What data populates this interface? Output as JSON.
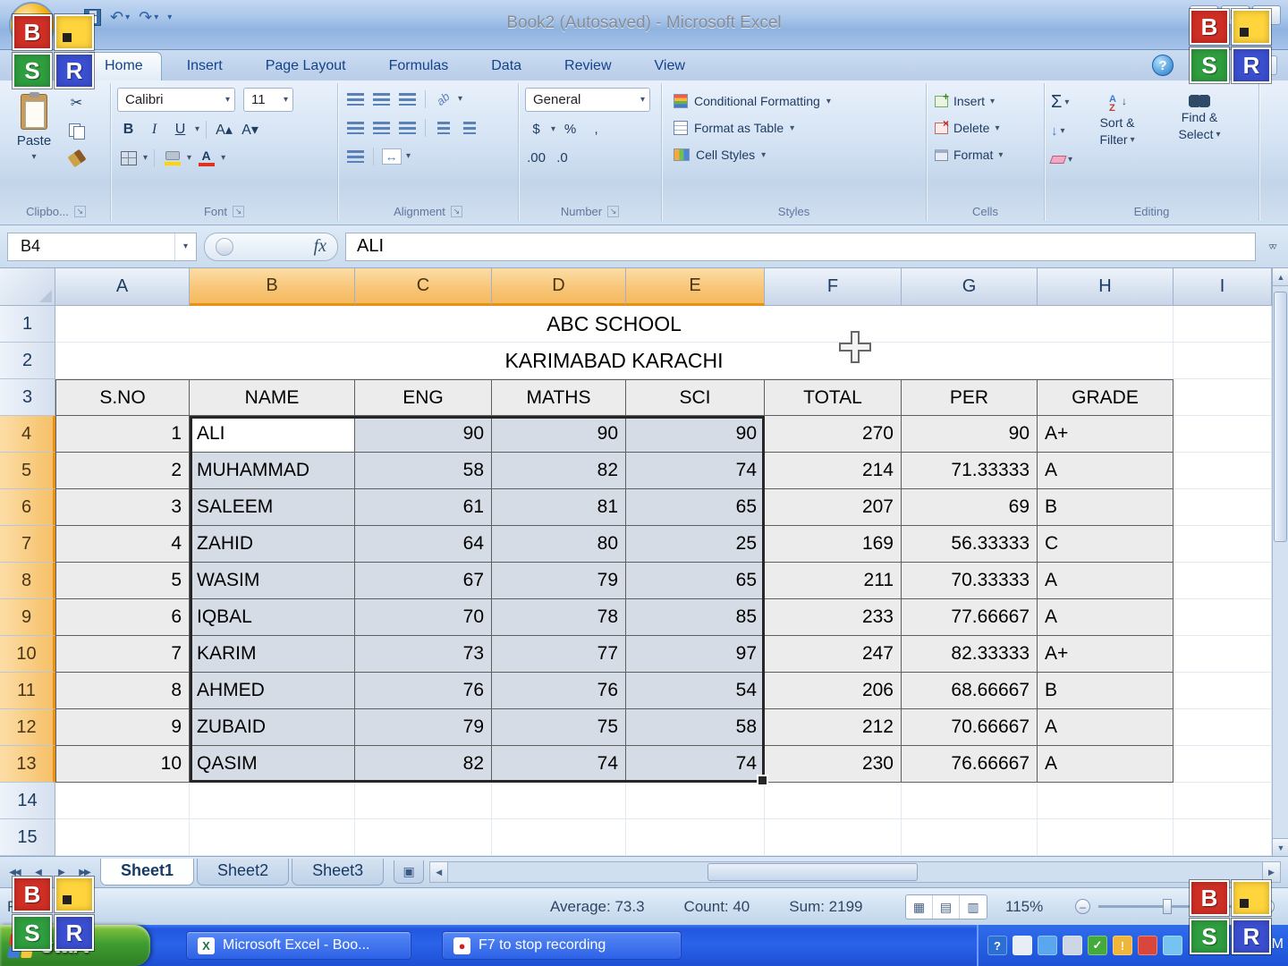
{
  "window": {
    "title": "Book2 (Autosaved) - Microsoft Excel",
    "minimize": "–",
    "maximize": "❐",
    "close": "×"
  },
  "icons": {
    "office-button": "css-shape",
    "save": "css-shape",
    "undo": "↶",
    "redo": "↷",
    "dropdown": "▾",
    "help": "?",
    "workbook-close": "×",
    "cut": "✂",
    "grow-font": "A▴",
    "shrink-font": "A▾",
    "orientation": "ab",
    "merge-center": "↔",
    "fill-down": "↓",
    "expand-formula-bar": "▿▿",
    "scroll-up": "▲",
    "scroll-down": "▼",
    "scroll-left": "◀",
    "scroll-right": "▶",
    "sheet-first": "◀◀",
    "sheet-prev": "◀",
    "sheet-next": "▶",
    "sheet-last": "▶▶",
    "insert-worksheet": "▣",
    "view-normal": "▦",
    "view-page-layout": "▤",
    "view-page-break": "▥",
    "zoom-out": "–",
    "zoom-in": "+",
    "sort-arrow": "↓"
  },
  "ribbon": {
    "tabs": [
      {
        "label": "Home",
        "active": true
      },
      {
        "label": "Insert"
      },
      {
        "label": "Page Layout"
      },
      {
        "label": "Formulas"
      },
      {
        "label": "Data"
      },
      {
        "label": "Review"
      },
      {
        "label": "View"
      }
    ],
    "groups": {
      "clipboard": {
        "label": "Clipbo...",
        "paste": "Paste"
      },
      "font": {
        "label": "Font",
        "name": "Calibri",
        "size": "11",
        "bold": "B",
        "italic": "I",
        "underline": "U"
      },
      "alignment": {
        "label": "Alignment"
      },
      "number": {
        "label": "Number",
        "format": "General",
        "currency": "$",
        "percent": "%",
        "comma": ",",
        "inc_decimal": ".00",
        "dec_decimal": ".0"
      },
      "styles": {
        "label": "Styles",
        "conditional": "Conditional Formatting",
        "table": "Format as Table",
        "cell_styles": "Cell Styles"
      },
      "cells": {
        "label": "Cells",
        "insert": "Insert",
        "delete": "Delete",
        "format": "Format"
      },
      "editing": {
        "label": "Editing",
        "autosum": "Σ",
        "sort_line1": "Sort &",
        "sort_line2": "Filter",
        "find_line1": "Find &",
        "find_line2": "Select"
      }
    }
  },
  "formula_bar": {
    "name_box": "B4",
    "fx": "fx",
    "content": "ALI"
  },
  "grid": {
    "columns": [
      "A",
      "B",
      "C",
      "D",
      "E",
      "F",
      "G",
      "H",
      "I"
    ],
    "selection": {
      "range": "B4:E13",
      "active_cell": "B4",
      "col_start": 1,
      "col_end": 4,
      "row_start": 4,
      "row_end": 13
    },
    "rows": [
      {
        "n": 1,
        "merged": "ABC SCHOOL"
      },
      {
        "n": 2,
        "merged": "KARIMABAD KARACHI"
      },
      {
        "n": 3,
        "header": true,
        "cells": [
          "S.NO",
          "NAME",
          "ENG",
          "MATHS",
          "SCI",
          "TOTAL",
          "PER",
          "GRADE"
        ]
      },
      {
        "n": 4,
        "cells": [
          "1",
          "ALI",
          "90",
          "90",
          "90",
          "270",
          "90",
          "A+"
        ]
      },
      {
        "n": 5,
        "cells": [
          "2",
          "MUHAMMAD",
          "58",
          "82",
          "74",
          "214",
          "71.33333",
          "A"
        ]
      },
      {
        "n": 6,
        "cells": [
          "3",
          "SALEEM",
          "61",
          "81",
          "65",
          "207",
          "69",
          "B"
        ]
      },
      {
        "n": 7,
        "cells": [
          "4",
          "ZAHID",
          "64",
          "80",
          "25",
          "169",
          "56.33333",
          "C"
        ]
      },
      {
        "n": 8,
        "cells": [
          "5",
          "WASIM",
          "67",
          "79",
          "65",
          "211",
          "70.33333",
          "A"
        ]
      },
      {
        "n": 9,
        "cells": [
          "6",
          "IQBAL",
          "70",
          "78",
          "85",
          "233",
          "77.66667",
          "A"
        ]
      },
      {
        "n": 10,
        "cells": [
          "7",
          "KARIM",
          "73",
          "77",
          "97",
          "247",
          "82.33333",
          "A+"
        ]
      },
      {
        "n": 11,
        "cells": [
          "8",
          "AHMED",
          "76",
          "76",
          "54",
          "206",
          "68.66667",
          "B"
        ]
      },
      {
        "n": 12,
        "cells": [
          "9",
          "ZUBAID",
          "79",
          "75",
          "58",
          "212",
          "70.66667",
          "A"
        ]
      },
      {
        "n": 13,
        "cells": [
          "10",
          "QASIM",
          "82",
          "74",
          "74",
          "230",
          "76.66667",
          "A"
        ]
      },
      {
        "n": 14,
        "cells": []
      },
      {
        "n": 15,
        "cells": []
      }
    ]
  },
  "sheet_bar": {
    "tabs": [
      {
        "label": "Sheet1",
        "active": true
      },
      {
        "label": "Sheet2"
      },
      {
        "label": "Sheet3"
      }
    ]
  },
  "status_bar": {
    "mode": "R",
    "average": "Average: 73.3",
    "count": "Count: 40",
    "sum": "Sum: 2199",
    "zoom": "115%"
  },
  "taskbar": {
    "start": "start",
    "tasks": [
      {
        "label": "Microsoft Excel - Boo...",
        "icon": "excel-icon",
        "glyph": "X"
      },
      {
        "label": "F7 to stop recording",
        "icon": "recorder-icon",
        "glyph": "●"
      }
    ],
    "tray_icons": [
      "help-icon",
      "input-icon",
      "network-icon",
      "display-icon",
      "shield-icon",
      "update-icon",
      "alert-icon",
      "messenger-icon"
    ],
    "clock": "5:54 AM"
  },
  "overlay": {
    "b": "B",
    "s": "S",
    "r": "R"
  },
  "colors": {
    "header_selected": "#f8c678",
    "selection_fill": "#d6dce5",
    "taskbar_blue": "#2a63e9",
    "start_green": "#3f9e31",
    "overlay_red": "#d02f25",
    "overlay_yellow": "#ffd43c",
    "overlay_green": "#2f9e3f",
    "overlay_blue": "#3b4fd1"
  }
}
